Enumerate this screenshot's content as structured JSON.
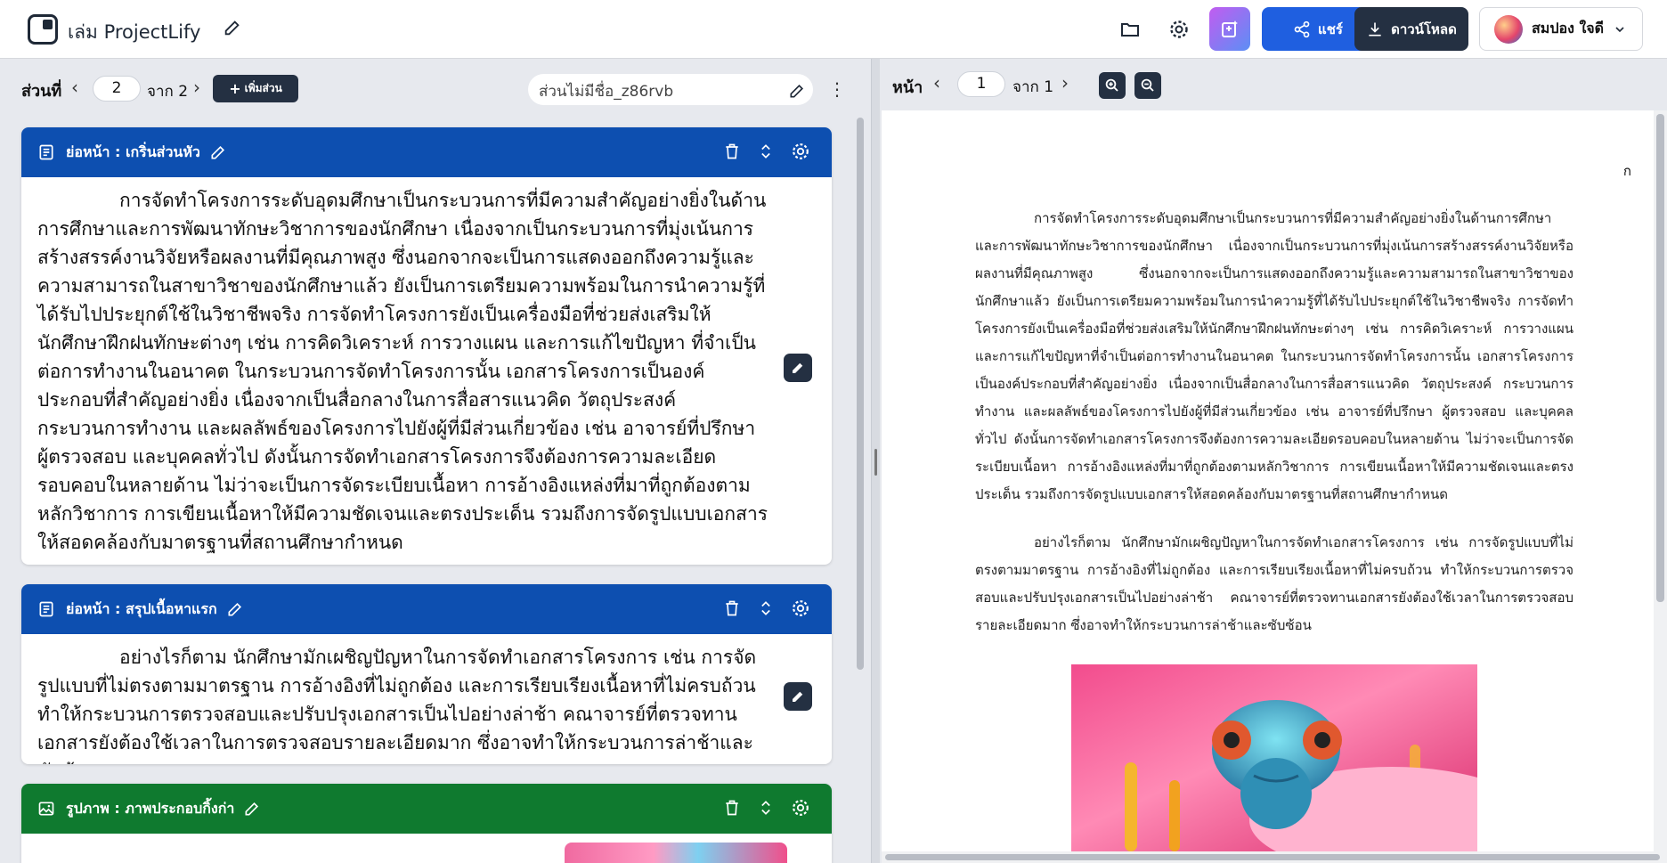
{
  "app": {
    "title": "เล่ม ProjectLify",
    "share_label": "แชร์",
    "download_label": "ดาวน์โหลด",
    "user_name": "สมปอง ใจดี"
  },
  "left": {
    "section_label": "ส่วนที่",
    "section_current": "2",
    "section_of": "จาก 2",
    "add_section_label": "เพิ่มส่วน",
    "section_name": "ส่วนไม่มีชื่อ_z86rvb"
  },
  "cards": [
    {
      "title": "ย่อหน้า : เกริ่นส่วนหัว",
      "kind": "paragraph",
      "color": "#0d4fb0",
      "text": "การจัดทำโครงการระดับอุดมศึกษาเป็นกระบวนการที่มีความสำคัญอย่างยิ่งในด้านการศึกษาและการพัฒนาทักษะวิชาการของนักศึกษา เนื่องจากเป็นกระบวนการที่มุ่งเน้นการสร้างสรรค์งานวิจัยหรือผลงานที่มีคุณภาพสูง ซึ่งนอกจากจะเป็นการแสดงออกถึงความรู้และความสามารถในสาขาวิชาของนักศึกษาแล้ว ยังเป็นการเตรียมความพร้อมในการนำความรู้ที่ได้รับไปประยุกต์ใช้ในวิชาชีพจริง การจัดทำโครงการยังเป็นเครื่องมือที่ช่วยส่งเสริมให้นักศึกษาฝึกฝนทักษะต่างๆ เช่น การคิดวิเคราะห์ การวางแผน และการแก้ไขปัญหา ที่จำเป็นต่อการทำงานในอนาคต ในกระบวนการจัดทำโครงการนั้น เอกสารโครงการเป็นองค์ประกอบที่สำคัญอย่างยิ่ง เนื่องจากเป็นสื่อกลางในการสื่อสารแนวคิด วัตถุประสงค์ กระบวนการทำงาน และผลลัพธ์ของโครงการไปยังผู้ที่มีส่วนเกี่ยวข้อง เช่น อาจารย์ที่ปรึกษา ผู้ตรวจสอบ และบุคคลทั่วไป ดังนั้นการจัดทำเอกสารโครงการจึงต้องการความละเอียดรอบคอบในหลายด้าน ไม่ว่าจะเป็นการจัดระเบียบเนื้อหา การอ้างอิงแหล่งที่มาที่ถูกต้องตามหลักวิชาการ การเขียนเนื้อหาให้มีความชัดเจนและตรงประเด็น รวมถึงการจัดรูปแบบเอกสารให้สอดคล้องกับมาตรฐานที่สถานศึกษากำหนด"
    },
    {
      "title": "ย่อหน้า : สรุปเนื้อหาแรก",
      "kind": "paragraph",
      "color": "#0d4fb0",
      "text": "อย่างไรก็ตาม นักศึกษามักเผชิญปัญหาในการจัดทำเอกสารโครงการ เช่น การจัดรูปแบบที่ไม่ตรงตามมาตรฐาน การอ้างอิงที่ไม่ถูกต้อง และการเรียบเรียงเนื้อหาที่ไม่ครบถ้วน ทำให้กระบวนการตรวจสอบและปรับปรุงเอกสารเป็นไปอย่างล่าช้า คณาจารย์ที่ตรวจทานเอกสารยังต้องใช้เวลาในการตรวจสอบรายละเอียดมาก ซึ่งอาจทำให้กระบวนการล่าช้าและซับซ้อน"
    },
    {
      "title": "รูปภาพ : ภาพประกอบกิ้งก่า",
      "kind": "image",
      "color": "#0f7a2f"
    }
  ],
  "right": {
    "page_label": "หน้า",
    "page_current": "1",
    "page_of": "จาก 1",
    "page_mark": "ก",
    "paragraphs": [
      "การจัดทำโครงการระดับอุดมศึกษาเป็นกระบวนการที่มีความสำคัญอย่างยิ่งในด้านการศึกษาและการพัฒนาทักษะวิชาการของนักศึกษา เนื่องจากเป็นกระบวนการที่มุ่งเน้นการสร้างสรรค์งานวิจัยหรือผลงานที่มีคุณภาพสูง ซึ่งนอกจากจะเป็นการแสดงออกถึงความรู้และความสามารถในสาขาวิชาของนักศึกษาแล้ว ยังเป็นการเตรียมความพร้อมในการนำความรู้ที่ได้รับไปประยุกต์ใช้ในวิชาชีพจริง การจัดทำโครงการยังเป็นเครื่องมือที่ช่วยส่งเสริมให้นักศึกษาฝึกฝนทักษะต่างๆ เช่น การคิดวิเคราะห์ การวางแผน และการแก้ไขปัญหาที่จำเป็นต่อการทำงานในอนาคต ในกระบวนการจัดทำโครงการนั้น เอกสารโครงการเป็นองค์ประกอบที่สำคัญอย่างยิ่ง เนื่องจากเป็นสื่อกลางในการสื่อสารแนวคิด วัตถุประสงค์ กระบวนการทำงาน และผลลัพธ์ของโครงการไปยังผู้ที่มีส่วนเกี่ยวข้อง เช่น อาจารย์ที่ปรึกษา ผู้ตรวจสอบ และบุคคลทั่วไป ดังนั้นการจัดทำเอกสารโครงการจึงต้องการความละเอียดรอบคอบในหลายด้าน ไม่ว่าจะเป็นการจัดระเบียบเนื้อหา การอ้างอิงแหล่งที่มาที่ถูกต้องตามหลักวิชาการ การเขียนเนื้อหาให้มีความชัดเจนและตรงประเด็น รวมถึงการจัดรูปแบบเอกสารให้สอดคล้องกับมาตรฐานที่สถานศึกษากำหนด",
      "อย่างไรก็ตาม นักศึกษามักเผชิญปัญหาในการจัดทำเอกสารโครงการ เช่น การจัดรูปแบบที่ไม่ตรงตามมาตรฐาน การอ้างอิงที่ไม่ถูกต้อง และการเรียบเรียงเนื้อหาที่ไม่ครบถ้วน ทำให้กระบวนการตรวจสอบและปรับปรุงเอกสารเป็นไปอย่างล่าช้า คณาจารย์ที่ตรวจทานเอกสารยังต้องใช้เวลาในการตรวจสอบรายละเอียดมาก ซึ่งอาจทำให้กระบวนการล่าช้าและซับซ้อน"
    ]
  },
  "colors": {
    "primary_blue": "#1f5fe0",
    "card_blue": "#0d4fb0",
    "card_green": "#0f7a2f",
    "dark": "#243042"
  }
}
